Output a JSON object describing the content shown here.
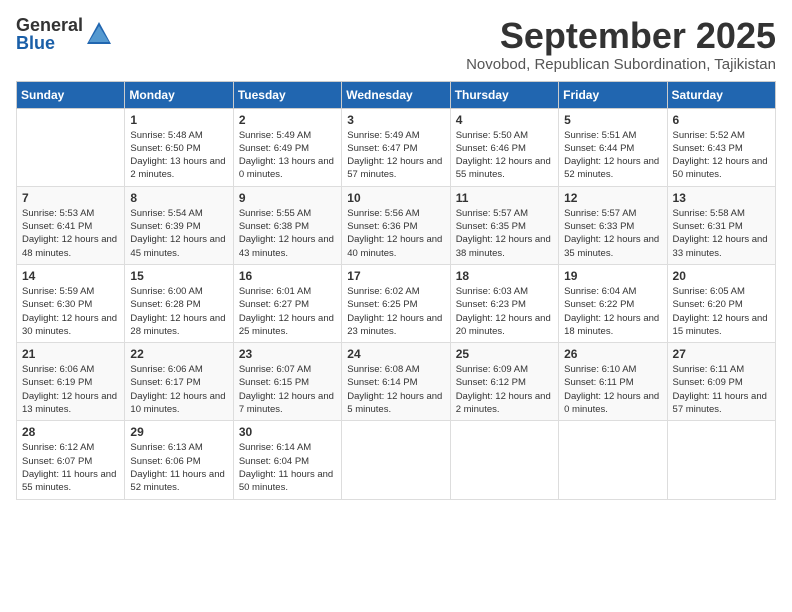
{
  "header": {
    "logo_general": "General",
    "logo_blue": "Blue",
    "month_title": "September 2025",
    "location": "Novobod, Republican Subordination, Tajikistan"
  },
  "weekdays": [
    "Sunday",
    "Monday",
    "Tuesday",
    "Wednesday",
    "Thursday",
    "Friday",
    "Saturday"
  ],
  "weeks": [
    [
      {
        "day": "",
        "sunrise": "",
        "sunset": "",
        "daylight": ""
      },
      {
        "day": "1",
        "sunrise": "Sunrise: 5:48 AM",
        "sunset": "Sunset: 6:50 PM",
        "daylight": "Daylight: 13 hours and 2 minutes."
      },
      {
        "day": "2",
        "sunrise": "Sunrise: 5:49 AM",
        "sunset": "Sunset: 6:49 PM",
        "daylight": "Daylight: 13 hours and 0 minutes."
      },
      {
        "day": "3",
        "sunrise": "Sunrise: 5:49 AM",
        "sunset": "Sunset: 6:47 PM",
        "daylight": "Daylight: 12 hours and 57 minutes."
      },
      {
        "day": "4",
        "sunrise": "Sunrise: 5:50 AM",
        "sunset": "Sunset: 6:46 PM",
        "daylight": "Daylight: 12 hours and 55 minutes."
      },
      {
        "day": "5",
        "sunrise": "Sunrise: 5:51 AM",
        "sunset": "Sunset: 6:44 PM",
        "daylight": "Daylight: 12 hours and 52 minutes."
      },
      {
        "day": "6",
        "sunrise": "Sunrise: 5:52 AM",
        "sunset": "Sunset: 6:43 PM",
        "daylight": "Daylight: 12 hours and 50 minutes."
      }
    ],
    [
      {
        "day": "7",
        "sunrise": "Sunrise: 5:53 AM",
        "sunset": "Sunset: 6:41 PM",
        "daylight": "Daylight: 12 hours and 48 minutes."
      },
      {
        "day": "8",
        "sunrise": "Sunrise: 5:54 AM",
        "sunset": "Sunset: 6:39 PM",
        "daylight": "Daylight: 12 hours and 45 minutes."
      },
      {
        "day": "9",
        "sunrise": "Sunrise: 5:55 AM",
        "sunset": "Sunset: 6:38 PM",
        "daylight": "Daylight: 12 hours and 43 minutes."
      },
      {
        "day": "10",
        "sunrise": "Sunrise: 5:56 AM",
        "sunset": "Sunset: 6:36 PM",
        "daylight": "Daylight: 12 hours and 40 minutes."
      },
      {
        "day": "11",
        "sunrise": "Sunrise: 5:57 AM",
        "sunset": "Sunset: 6:35 PM",
        "daylight": "Daylight: 12 hours and 38 minutes."
      },
      {
        "day": "12",
        "sunrise": "Sunrise: 5:57 AM",
        "sunset": "Sunset: 6:33 PM",
        "daylight": "Daylight: 12 hours and 35 minutes."
      },
      {
        "day": "13",
        "sunrise": "Sunrise: 5:58 AM",
        "sunset": "Sunset: 6:31 PM",
        "daylight": "Daylight: 12 hours and 33 minutes."
      }
    ],
    [
      {
        "day": "14",
        "sunrise": "Sunrise: 5:59 AM",
        "sunset": "Sunset: 6:30 PM",
        "daylight": "Daylight: 12 hours and 30 minutes."
      },
      {
        "day": "15",
        "sunrise": "Sunrise: 6:00 AM",
        "sunset": "Sunset: 6:28 PM",
        "daylight": "Daylight: 12 hours and 28 minutes."
      },
      {
        "day": "16",
        "sunrise": "Sunrise: 6:01 AM",
        "sunset": "Sunset: 6:27 PM",
        "daylight": "Daylight: 12 hours and 25 minutes."
      },
      {
        "day": "17",
        "sunrise": "Sunrise: 6:02 AM",
        "sunset": "Sunset: 6:25 PM",
        "daylight": "Daylight: 12 hours and 23 minutes."
      },
      {
        "day": "18",
        "sunrise": "Sunrise: 6:03 AM",
        "sunset": "Sunset: 6:23 PM",
        "daylight": "Daylight: 12 hours and 20 minutes."
      },
      {
        "day": "19",
        "sunrise": "Sunrise: 6:04 AM",
        "sunset": "Sunset: 6:22 PM",
        "daylight": "Daylight: 12 hours and 18 minutes."
      },
      {
        "day": "20",
        "sunrise": "Sunrise: 6:05 AM",
        "sunset": "Sunset: 6:20 PM",
        "daylight": "Daylight: 12 hours and 15 minutes."
      }
    ],
    [
      {
        "day": "21",
        "sunrise": "Sunrise: 6:06 AM",
        "sunset": "Sunset: 6:19 PM",
        "daylight": "Daylight: 12 hours and 13 minutes."
      },
      {
        "day": "22",
        "sunrise": "Sunrise: 6:06 AM",
        "sunset": "Sunset: 6:17 PM",
        "daylight": "Daylight: 12 hours and 10 minutes."
      },
      {
        "day": "23",
        "sunrise": "Sunrise: 6:07 AM",
        "sunset": "Sunset: 6:15 PM",
        "daylight": "Daylight: 12 hours and 7 minutes."
      },
      {
        "day": "24",
        "sunrise": "Sunrise: 6:08 AM",
        "sunset": "Sunset: 6:14 PM",
        "daylight": "Daylight: 12 hours and 5 minutes."
      },
      {
        "day": "25",
        "sunrise": "Sunrise: 6:09 AM",
        "sunset": "Sunset: 6:12 PM",
        "daylight": "Daylight: 12 hours and 2 minutes."
      },
      {
        "day": "26",
        "sunrise": "Sunrise: 6:10 AM",
        "sunset": "Sunset: 6:11 PM",
        "daylight": "Daylight: 12 hours and 0 minutes."
      },
      {
        "day": "27",
        "sunrise": "Sunrise: 6:11 AM",
        "sunset": "Sunset: 6:09 PM",
        "daylight": "Daylight: 11 hours and 57 minutes."
      }
    ],
    [
      {
        "day": "28",
        "sunrise": "Sunrise: 6:12 AM",
        "sunset": "Sunset: 6:07 PM",
        "daylight": "Daylight: 11 hours and 55 minutes."
      },
      {
        "day": "29",
        "sunrise": "Sunrise: 6:13 AM",
        "sunset": "Sunset: 6:06 PM",
        "daylight": "Daylight: 11 hours and 52 minutes."
      },
      {
        "day": "30",
        "sunrise": "Sunrise: 6:14 AM",
        "sunset": "Sunset: 6:04 PM",
        "daylight": "Daylight: 11 hours and 50 minutes."
      },
      {
        "day": "",
        "sunrise": "",
        "sunset": "",
        "daylight": ""
      },
      {
        "day": "",
        "sunrise": "",
        "sunset": "",
        "daylight": ""
      },
      {
        "day": "",
        "sunrise": "",
        "sunset": "",
        "daylight": ""
      },
      {
        "day": "",
        "sunrise": "",
        "sunset": "",
        "daylight": ""
      }
    ]
  ]
}
